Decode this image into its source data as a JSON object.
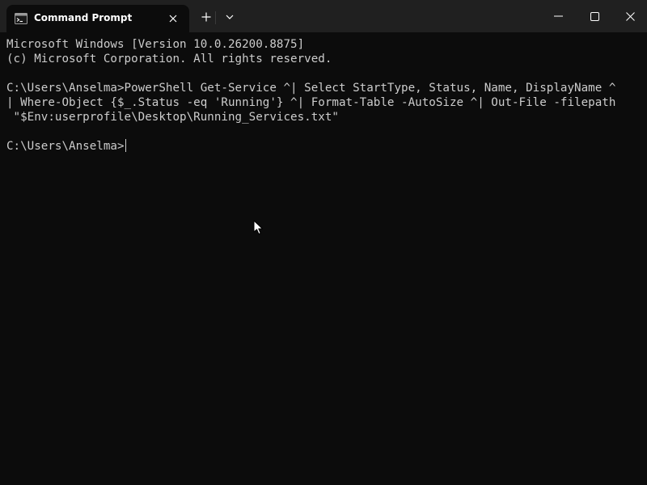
{
  "tab": {
    "title": "Command Prompt",
    "icon": "command-prompt-icon"
  },
  "toolbar": {
    "new_tab_icon": "plus-icon",
    "dropdown_icon": "chevron-down-icon"
  },
  "window_controls": {
    "minimize_icon": "minimize-icon",
    "maximize_icon": "maximize-icon",
    "close_icon": "close-icon"
  },
  "terminal": {
    "lines": [
      "Microsoft Windows [Version 10.0.26200.8875]",
      "(c) Microsoft Corporation. All rights reserved.",
      "",
      "C:\\Users\\Anselma>PowerShell Get-Service ^| Select StartType, Status, Name, DisplayName ^",
      "| Where-Object {$_.Status -eq 'Running'} ^| Format-Table -AutoSize ^| Out-File -filepath",
      " \"$Env:userprofile\\Desktop\\Running_Services.txt\"",
      ""
    ],
    "prompt": "C:\\Users\\Anselma>"
  },
  "colors": {
    "background": "#0c0c0c",
    "titlebar": "#202020",
    "text": "#cccccc"
  }
}
